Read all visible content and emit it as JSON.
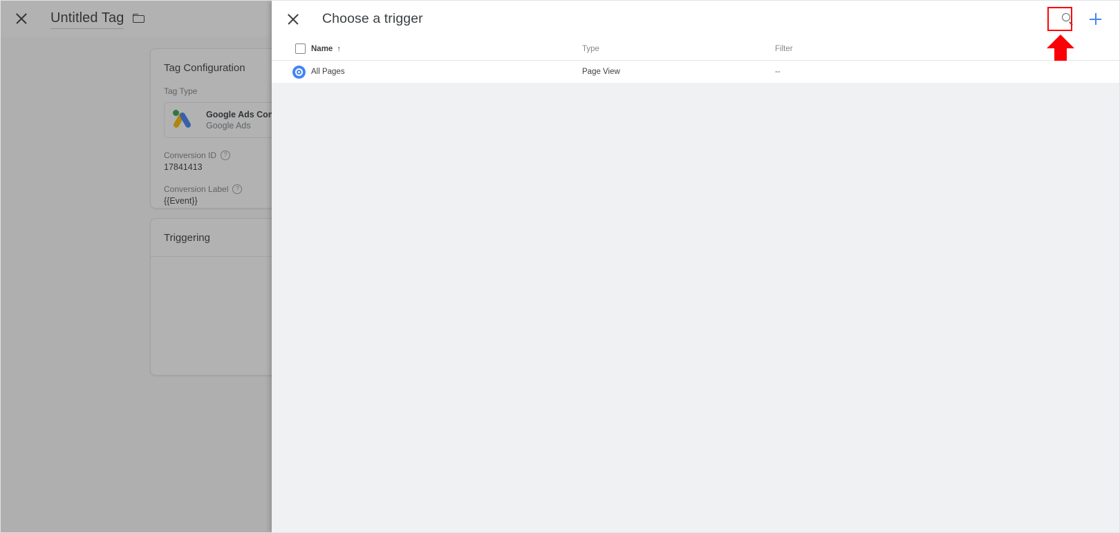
{
  "background_app": {
    "close_icon": "close-icon",
    "title": "Untitled Tag",
    "folder_icon": "folder-icon",
    "tag_configuration": {
      "section_title": "Tag Configuration",
      "tag_type_label": "Tag Type",
      "tag_type_name": "Google Ads Conversion Tracking",
      "tag_type_vendor": "Google Ads",
      "vendor_icon": "google-ads-logo-icon",
      "fields": [
        {
          "label": "Conversion ID",
          "help_icon": "help-icon",
          "help_glyph": "?",
          "value": "17841413"
        },
        {
          "label": "Conversion Label",
          "help_icon": "help-icon",
          "help_glyph": "?",
          "value": "{{Event}}"
        }
      ]
    },
    "triggering": {
      "section_title": "Triggering"
    }
  },
  "dialog": {
    "close_icon": "close-icon",
    "title": "Choose a trigger",
    "search_icon": "search-icon",
    "add_icon": "plus-icon",
    "table": {
      "select_all_checkbox": "checkbox-unchecked",
      "columns": [
        {
          "key": "name",
          "label": "Name",
          "sorted": true,
          "sort_glyph": "↑"
        },
        {
          "key": "type",
          "label": "Type",
          "sorted": false
        },
        {
          "key": "filter",
          "label": "Filter",
          "sorted": false
        }
      ],
      "rows": [
        {
          "icon": "page-view-trigger-icon",
          "name": "All Pages",
          "type": "Page View",
          "filter": "--"
        }
      ]
    }
  },
  "annotations": {
    "highlight_color": "#fb0007",
    "highlight_target": "add-trigger-button",
    "arrow_direction": "up"
  }
}
